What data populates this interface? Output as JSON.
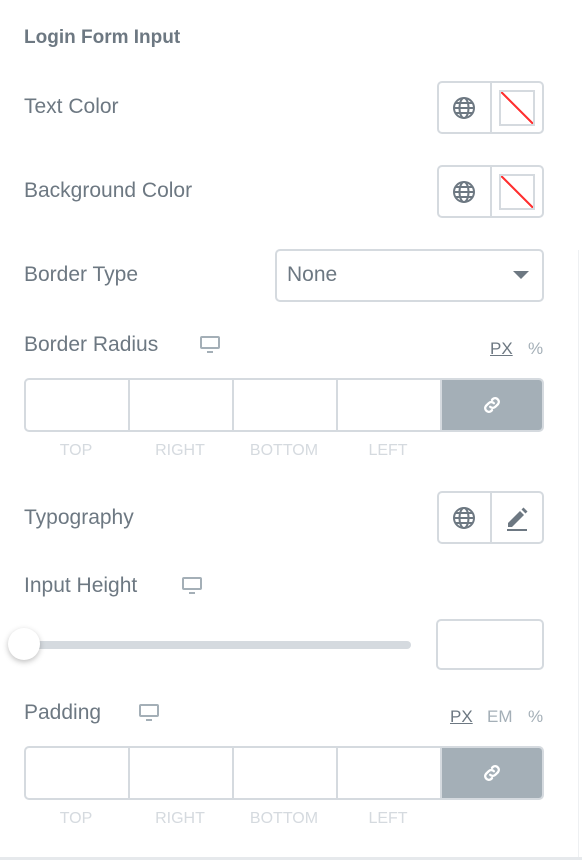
{
  "section": {
    "title": "Login Form Input"
  },
  "text_color": {
    "label": "Text Color"
  },
  "background_color": {
    "label": "Background Color"
  },
  "border_type": {
    "label": "Border Type",
    "value": "None"
  },
  "border_radius": {
    "label": "Border Radius",
    "units": [
      "PX",
      "%"
    ],
    "active_unit": "PX",
    "sides": [
      "TOP",
      "RIGHT",
      "BOTTOM",
      "LEFT"
    ]
  },
  "typography": {
    "label": "Typography"
  },
  "input_height": {
    "label": "Input Height",
    "slider_value": 0
  },
  "padding": {
    "label": "Padding",
    "units": [
      "PX",
      "EM",
      "%"
    ],
    "active_unit": "PX",
    "sides": [
      "TOP",
      "RIGHT",
      "BOTTOM",
      "LEFT"
    ]
  },
  "colors": {
    "text": "#6d7882",
    "border": "#d5dadf",
    "link_button": "#a4afb7"
  }
}
